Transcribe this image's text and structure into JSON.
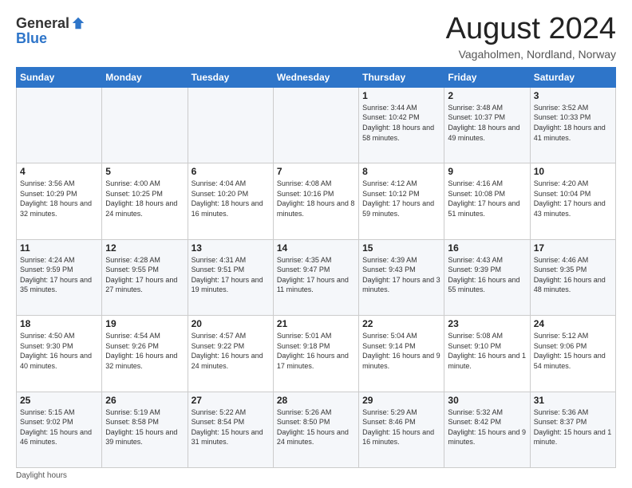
{
  "logo": {
    "general": "General",
    "blue": "Blue"
  },
  "title": "August 2024",
  "subtitle": "Vagaholmen, Nordland, Norway",
  "headers": [
    "Sunday",
    "Monday",
    "Tuesday",
    "Wednesday",
    "Thursday",
    "Friday",
    "Saturday"
  ],
  "footer": "Daylight hours",
  "weeks": [
    [
      {
        "day": "",
        "sunrise": "",
        "sunset": "",
        "daylight": ""
      },
      {
        "day": "",
        "sunrise": "",
        "sunset": "",
        "daylight": ""
      },
      {
        "day": "",
        "sunrise": "",
        "sunset": "",
        "daylight": ""
      },
      {
        "day": "",
        "sunrise": "",
        "sunset": "",
        "daylight": ""
      },
      {
        "day": "1",
        "sunrise": "Sunrise: 3:44 AM",
        "sunset": "Sunset: 10:42 PM",
        "daylight": "Daylight: 18 hours and 58 minutes."
      },
      {
        "day": "2",
        "sunrise": "Sunrise: 3:48 AM",
        "sunset": "Sunset: 10:37 PM",
        "daylight": "Daylight: 18 hours and 49 minutes."
      },
      {
        "day": "3",
        "sunrise": "Sunrise: 3:52 AM",
        "sunset": "Sunset: 10:33 PM",
        "daylight": "Daylight: 18 hours and 41 minutes."
      }
    ],
    [
      {
        "day": "4",
        "sunrise": "Sunrise: 3:56 AM",
        "sunset": "Sunset: 10:29 PM",
        "daylight": "Daylight: 18 hours and 32 minutes."
      },
      {
        "day": "5",
        "sunrise": "Sunrise: 4:00 AM",
        "sunset": "Sunset: 10:25 PM",
        "daylight": "Daylight: 18 hours and 24 minutes."
      },
      {
        "day": "6",
        "sunrise": "Sunrise: 4:04 AM",
        "sunset": "Sunset: 10:20 PM",
        "daylight": "Daylight: 18 hours and 16 minutes."
      },
      {
        "day": "7",
        "sunrise": "Sunrise: 4:08 AM",
        "sunset": "Sunset: 10:16 PM",
        "daylight": "Daylight: 18 hours and 8 minutes."
      },
      {
        "day": "8",
        "sunrise": "Sunrise: 4:12 AM",
        "sunset": "Sunset: 10:12 PM",
        "daylight": "Daylight: 17 hours and 59 minutes."
      },
      {
        "day": "9",
        "sunrise": "Sunrise: 4:16 AM",
        "sunset": "Sunset: 10:08 PM",
        "daylight": "Daylight: 17 hours and 51 minutes."
      },
      {
        "day": "10",
        "sunrise": "Sunrise: 4:20 AM",
        "sunset": "Sunset: 10:04 PM",
        "daylight": "Daylight: 17 hours and 43 minutes."
      }
    ],
    [
      {
        "day": "11",
        "sunrise": "Sunrise: 4:24 AM",
        "sunset": "Sunset: 9:59 PM",
        "daylight": "Daylight: 17 hours and 35 minutes."
      },
      {
        "day": "12",
        "sunrise": "Sunrise: 4:28 AM",
        "sunset": "Sunset: 9:55 PM",
        "daylight": "Daylight: 17 hours and 27 minutes."
      },
      {
        "day": "13",
        "sunrise": "Sunrise: 4:31 AM",
        "sunset": "Sunset: 9:51 PM",
        "daylight": "Daylight: 17 hours and 19 minutes."
      },
      {
        "day": "14",
        "sunrise": "Sunrise: 4:35 AM",
        "sunset": "Sunset: 9:47 PM",
        "daylight": "Daylight: 17 hours and 11 minutes."
      },
      {
        "day": "15",
        "sunrise": "Sunrise: 4:39 AM",
        "sunset": "Sunset: 9:43 PM",
        "daylight": "Daylight: 17 hours and 3 minutes."
      },
      {
        "day": "16",
        "sunrise": "Sunrise: 4:43 AM",
        "sunset": "Sunset: 9:39 PM",
        "daylight": "Daylight: 16 hours and 55 minutes."
      },
      {
        "day": "17",
        "sunrise": "Sunrise: 4:46 AM",
        "sunset": "Sunset: 9:35 PM",
        "daylight": "Daylight: 16 hours and 48 minutes."
      }
    ],
    [
      {
        "day": "18",
        "sunrise": "Sunrise: 4:50 AM",
        "sunset": "Sunset: 9:30 PM",
        "daylight": "Daylight: 16 hours and 40 minutes."
      },
      {
        "day": "19",
        "sunrise": "Sunrise: 4:54 AM",
        "sunset": "Sunset: 9:26 PM",
        "daylight": "Daylight: 16 hours and 32 minutes."
      },
      {
        "day": "20",
        "sunrise": "Sunrise: 4:57 AM",
        "sunset": "Sunset: 9:22 PM",
        "daylight": "Daylight: 16 hours and 24 minutes."
      },
      {
        "day": "21",
        "sunrise": "Sunrise: 5:01 AM",
        "sunset": "Sunset: 9:18 PM",
        "daylight": "Daylight: 16 hours and 17 minutes."
      },
      {
        "day": "22",
        "sunrise": "Sunrise: 5:04 AM",
        "sunset": "Sunset: 9:14 PM",
        "daylight": "Daylight: 16 hours and 9 minutes."
      },
      {
        "day": "23",
        "sunrise": "Sunrise: 5:08 AM",
        "sunset": "Sunset: 9:10 PM",
        "daylight": "Daylight: 16 hours and 1 minute."
      },
      {
        "day": "24",
        "sunrise": "Sunrise: 5:12 AM",
        "sunset": "Sunset: 9:06 PM",
        "daylight": "Daylight: 15 hours and 54 minutes."
      }
    ],
    [
      {
        "day": "25",
        "sunrise": "Sunrise: 5:15 AM",
        "sunset": "Sunset: 9:02 PM",
        "daylight": "Daylight: 15 hours and 46 minutes."
      },
      {
        "day": "26",
        "sunrise": "Sunrise: 5:19 AM",
        "sunset": "Sunset: 8:58 PM",
        "daylight": "Daylight: 15 hours and 39 minutes."
      },
      {
        "day": "27",
        "sunrise": "Sunrise: 5:22 AM",
        "sunset": "Sunset: 8:54 PM",
        "daylight": "Daylight: 15 hours and 31 minutes."
      },
      {
        "day": "28",
        "sunrise": "Sunrise: 5:26 AM",
        "sunset": "Sunset: 8:50 PM",
        "daylight": "Daylight: 15 hours and 24 minutes."
      },
      {
        "day": "29",
        "sunrise": "Sunrise: 5:29 AM",
        "sunset": "Sunset: 8:46 PM",
        "daylight": "Daylight: 15 hours and 16 minutes."
      },
      {
        "day": "30",
        "sunrise": "Sunrise: 5:32 AM",
        "sunset": "Sunset: 8:42 PM",
        "daylight": "Daylight: 15 hours and 9 minutes."
      },
      {
        "day": "31",
        "sunrise": "Sunrise: 5:36 AM",
        "sunset": "Sunset: 8:37 PM",
        "daylight": "Daylight: 15 hours and 1 minute."
      }
    ]
  ]
}
